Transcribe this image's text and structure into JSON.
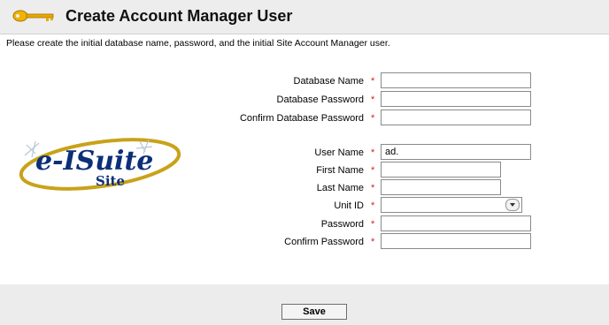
{
  "header": {
    "title": "Create Account Manager User",
    "icon": "key-icon"
  },
  "intro": "Please create the initial database name, password, and the initial Site Account Manager user.",
  "logo": {
    "text_main": "e-ISuite",
    "text_sub": "Site"
  },
  "required_marker": "*",
  "form": {
    "database_name": {
      "label": "Database Name",
      "value": ""
    },
    "database_password": {
      "label": "Database Password",
      "value": ""
    },
    "confirm_database_password": {
      "label": "Confirm Database Password",
      "value": ""
    },
    "user_name": {
      "label": "User Name",
      "value": "ad."
    },
    "first_name": {
      "label": "First Name",
      "value": ""
    },
    "last_name": {
      "label": "Last Name",
      "value": ""
    },
    "unit_id": {
      "label": "Unit ID",
      "value": ""
    },
    "password": {
      "label": "Password",
      "value": ""
    },
    "confirm_password": {
      "label": "Confirm Password",
      "value": ""
    }
  },
  "footer": {
    "save_label": "Save"
  },
  "colors": {
    "header_bg": "#ededed",
    "required": "#d81e1e",
    "footer_bg": "#ececec"
  }
}
